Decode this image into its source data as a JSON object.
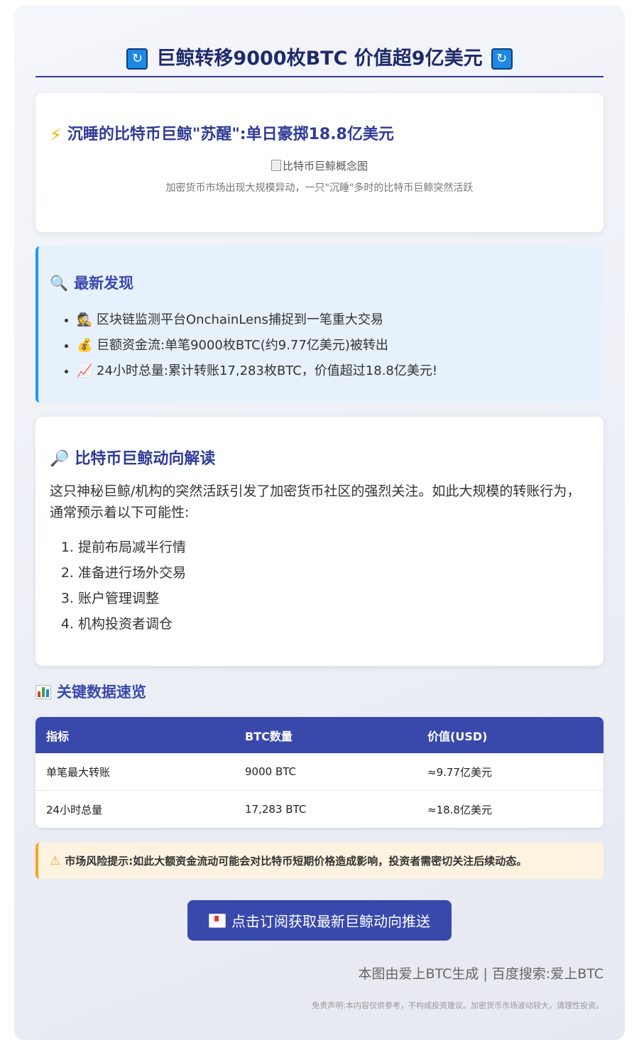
{
  "header": {
    "title": "巨鲸转移9000枚BTC 价值超9亿美元"
  },
  "hero": {
    "title": "沉睡的比特币巨鲸\"苏醒\":单日豪掷18.8亿美元",
    "image_alt": "比特币巨鲸概念图",
    "caption": "加密货币市场出现大规模异动，一只\"沉睡\"多时的比特币巨鲸突然活跃"
  },
  "findings": {
    "title": "最新发现",
    "items": [
      {
        "icon": "detective",
        "text": "区块链监测平台OnchainLens捕捉到一笔重大交易"
      },
      {
        "icon": "money-bag",
        "text": "巨额资金流:单笔9000枚BTC(约9.77亿美元)被转出"
      },
      {
        "icon": "chart-increasing",
        "text": "24小时总量:累计转账17,283枚BTC，价值超过18.8亿美元!"
      }
    ]
  },
  "analysis": {
    "title": "比特币巨鲸动向解读",
    "paragraph": "这只神秘巨鲸/机构的突然活跃引发了加密货币社区的强烈关注。如此大规模的转账行为，通常预示着以下可能性:",
    "items": [
      "提前布局减半行情",
      "准备进行场外交易",
      "账户管理调整",
      "机构投资者调仓"
    ]
  },
  "data_table": {
    "title": "关键数据速览",
    "headers": [
      "指标",
      "BTC数量",
      "价值(USD)"
    ],
    "rows": [
      [
        "单笔最大转账",
        "9000 BTC",
        "≈9.77亿美元"
      ],
      [
        "24小时总量",
        "17,283 BTC",
        "≈18.8亿美元"
      ]
    ]
  },
  "warning": {
    "text": "市场风险提示:如此大额资金流动可能会对比特币短期价格造成影响，投资者需密切关注后续动态。"
  },
  "cta": {
    "label": "点击订阅获取最新巨鲸动向推送"
  },
  "footer": {
    "generated_by": "本图由爱上BTC生成 | 百度搜索:爱上BTC",
    "disclaimer": "免责声明:本内容仅供参考，不构成投资建议。加密货币市场波动较大，请理性投资。"
  },
  "colors": {
    "accent": "#3949ab",
    "info_border": "#2196f3",
    "warning_border": "#f5a623"
  }
}
